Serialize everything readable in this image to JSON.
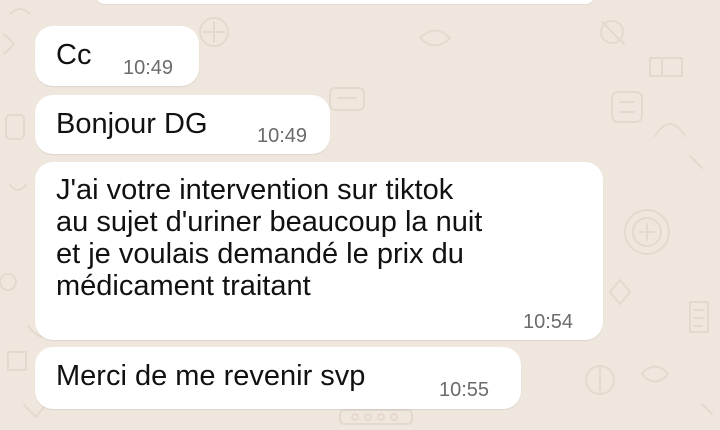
{
  "chat": {
    "messages": [
      {
        "text": "Cc",
        "time": "10:49"
      },
      {
        "text": "Bonjour DG",
        "time": "10:49"
      },
      {
        "text": "J'ai votre intervention sur tiktok\nau sujet d'uriner beaucoup la nuit\net je voulais demandé le prix du\nmédicament traitant",
        "time": "10:54"
      },
      {
        "text": "Merci de me revenir svp",
        "time": "10:55"
      }
    ]
  },
  "theme": {
    "wallpaper_color": "#efe7de",
    "bubble_color": "#ffffff",
    "text_color": "#111111",
    "time_color": "#6b6b6b"
  }
}
